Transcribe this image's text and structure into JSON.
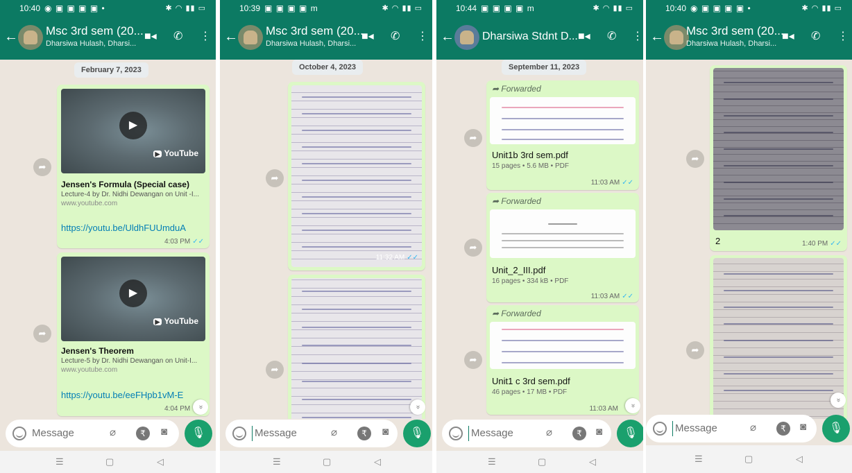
{
  "colors": {
    "header": "#0c7a63",
    "bubble_out": "#dcf8c6",
    "wallpaper": "#ece5dd",
    "mic": "#1aa06d",
    "link": "#027eb5"
  },
  "icons": {
    "back": "arrow-left-icon",
    "video": "video-camera-icon",
    "call": "phone-icon",
    "menu": "kebab-menu-icon",
    "forward": "share-forward-icon",
    "emoji": "emoji-icon",
    "attach": "paperclip-icon",
    "payment": "rupee-icon",
    "camera": "camera-icon",
    "mic": "microphone-icon"
  },
  "common": {
    "message_placeholder": "Message",
    "forwarded_label": "Forwarded",
    "scroll_down_glyph": "»",
    "nav_menu": "☰",
    "nav_home": "▢",
    "nav_back": "◁"
  },
  "screens": [
    {
      "status_time": "10:40",
      "title": "Msc 3rd sem (20...",
      "subtitle": "Dharsiwa Hulash, Dharsi...",
      "date": "February 7, 2023",
      "messages": [
        {
          "title": "Jensen's Formula (Special case)",
          "desc": "Lecture-4 by Dr. Nidhi Dewangan on Unit -I...",
          "domain": "www.youtube.com",
          "url": "https://youtu.be/UldhFUUmduA",
          "time": "4:03 PM",
          "yt": "YouTube"
        },
        {
          "title": "Jensen's Theorem",
          "desc": "Lecture-5 by Dr. Nidhi Dewangan on Unit-I...",
          "domain": "www.youtube.com",
          "url": "https://youtu.be/eeFHpb1vM-E",
          "time": "4:04 PM",
          "yt": "YouTube"
        }
      ]
    },
    {
      "status_time": "10:39",
      "title": "Msc 3rd sem (20...",
      "subtitle": "Dharsiwa Hulash, Dharsi...",
      "date": "October 4, 2023",
      "images": [
        {
          "time": "11:32 AM"
        }
      ]
    },
    {
      "status_time": "10:44",
      "title": "Dharsiwa Stdnt D...",
      "date": "September 11, 2023",
      "docs": [
        {
          "name": "Unit1b 3rd sem.pdf",
          "meta": "15 pages • 5.6 MB • PDF",
          "time": "11:03 AM"
        },
        {
          "name": "Unit_2_III.pdf",
          "meta": "16 pages • 334 kB • PDF",
          "time": "11:03 AM"
        },
        {
          "name": "Unit1 c 3rd sem.pdf",
          "meta": "46 pages • 17 MB • PDF",
          "time": "11:03 AM"
        }
      ]
    },
    {
      "status_time": "10:40",
      "title": "Msc 3rd sem (20...",
      "subtitle": "Dharsiwa Hulash, Dharsi...",
      "images": [
        {
          "caption": "2",
          "time": "1:40 PM"
        }
      ]
    }
  ]
}
